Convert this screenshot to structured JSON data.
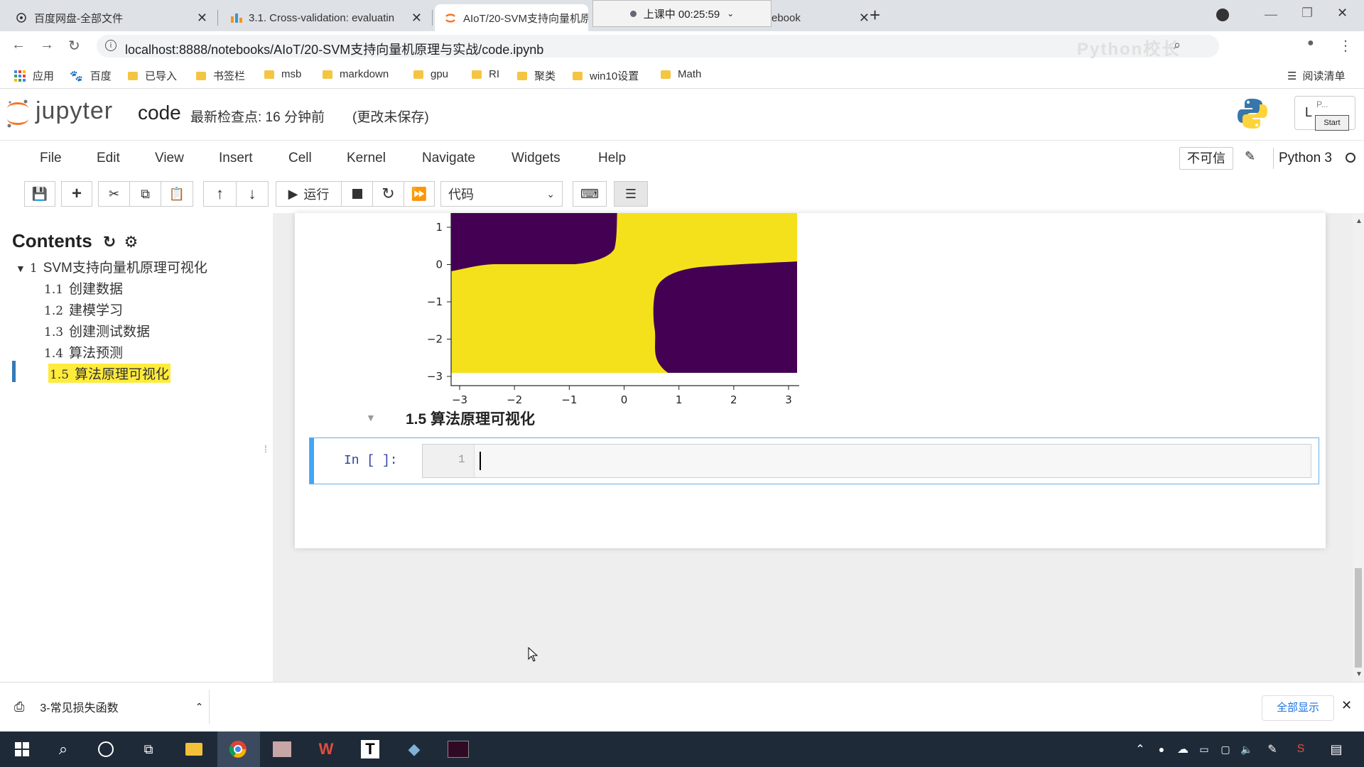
{
  "browser": {
    "tabs": [
      {
        "title": "百度网盘-全部文件"
      },
      {
        "title": "3.1. Cross-validation: evaluatin"
      },
      {
        "title": "AIoT/20-SVM支持向量机原"
      },
      {
        "title": "ebook"
      }
    ],
    "recording_badge": "上课中 00:25:59",
    "url": "localhost:8888/notebooks/AIoT/20-SVM支持向量机原理与实战/code.ipynb",
    "watermark": "Python校长"
  },
  "bookmarks": {
    "items": [
      "应用",
      "百度",
      "已导入",
      "书签栏",
      "msb",
      "markdown",
      "gpu",
      "RI",
      "聚类",
      "win10设置",
      "Math"
    ],
    "reading_list": "阅读清单"
  },
  "jupyter": {
    "logo_text": "jupyter",
    "notebook_name": "code",
    "checkpoint": "最新检查点: 16 分钟前",
    "unsaved": "(更改未保存)",
    "start_label": "Start",
    "login_short": "L",
    "p_label": "P..."
  },
  "menu": {
    "items": [
      "File",
      "Edit",
      "View",
      "Insert",
      "Cell",
      "Kernel",
      "Navigate",
      "Widgets",
      "Help"
    ],
    "trusted": "不可信",
    "kernel": "Python 3"
  },
  "toolbar": {
    "run_label": "运行",
    "cell_type": "代码"
  },
  "toc": {
    "title": "Contents",
    "items": [
      {
        "num": "1",
        "label": "SVM支持向量机原理可视化"
      },
      {
        "num": "1.1",
        "label": "创建数据"
      },
      {
        "num": "1.2",
        "label": "建模学习"
      },
      {
        "num": "1.3",
        "label": "创建测试数据"
      },
      {
        "num": "1.4",
        "label": "算法预测"
      },
      {
        "num": "1.5",
        "label": "算法原理可视化"
      }
    ]
  },
  "cell": {
    "heading": "1.5  算法原理可视化",
    "prompt": "In  [ ]:",
    "line_number": "1"
  },
  "chart_data": {
    "type": "heatmap",
    "x_ticks": [
      "−3",
      "−2",
      "−1",
      "0",
      "1",
      "2",
      "3"
    ],
    "y_ticks": [
      "1",
      "0",
      "−1",
      "−2",
      "−3"
    ],
    "xlim": [
      -3,
      3
    ],
    "ylim": [
      -3,
      1.4
    ],
    "classes": [
      {
        "label": "yellow",
        "color": "#f5e11b"
      },
      {
        "label": "purple",
        "color": "#440154"
      }
    ]
  },
  "downloads": {
    "file": "3-常见损失函数",
    "show_all": "全部显示"
  }
}
